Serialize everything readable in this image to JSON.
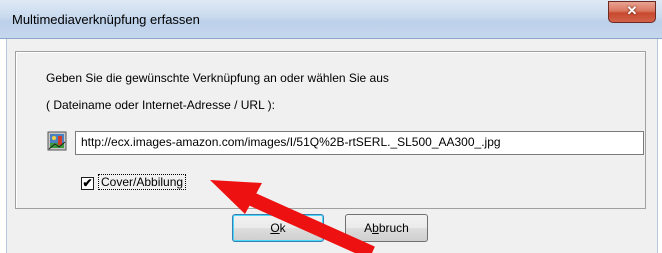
{
  "window": {
    "title": "Multimediaverknüpfung erfassen"
  },
  "titlebar": {
    "close_icon": "close-icon",
    "close_glyph": "✕"
  },
  "dialog": {
    "instruction_line1": "Geben Sie die gewünschte Verknüpfung an oder wählen Sie aus",
    "instruction_line2": "( Dateiname oder Internet-Adresse / URL ):",
    "link_icon": "multimedia-link-icon",
    "url_value": "http://ecx.images-amazon.com/images/I/51Q%2B-rtSERL._SL500_AA300_.jpg",
    "checkbox_label": "Cover/Abbilung",
    "checkbox_checked": true,
    "checkbox_glyph": "✔",
    "ok_accel": "O",
    "ok_rest": "k",
    "cancel_pre": "A",
    "cancel_accel": "b",
    "cancel_rest": "bruch"
  },
  "annotation": {
    "arrow_color": "#ee1111"
  }
}
